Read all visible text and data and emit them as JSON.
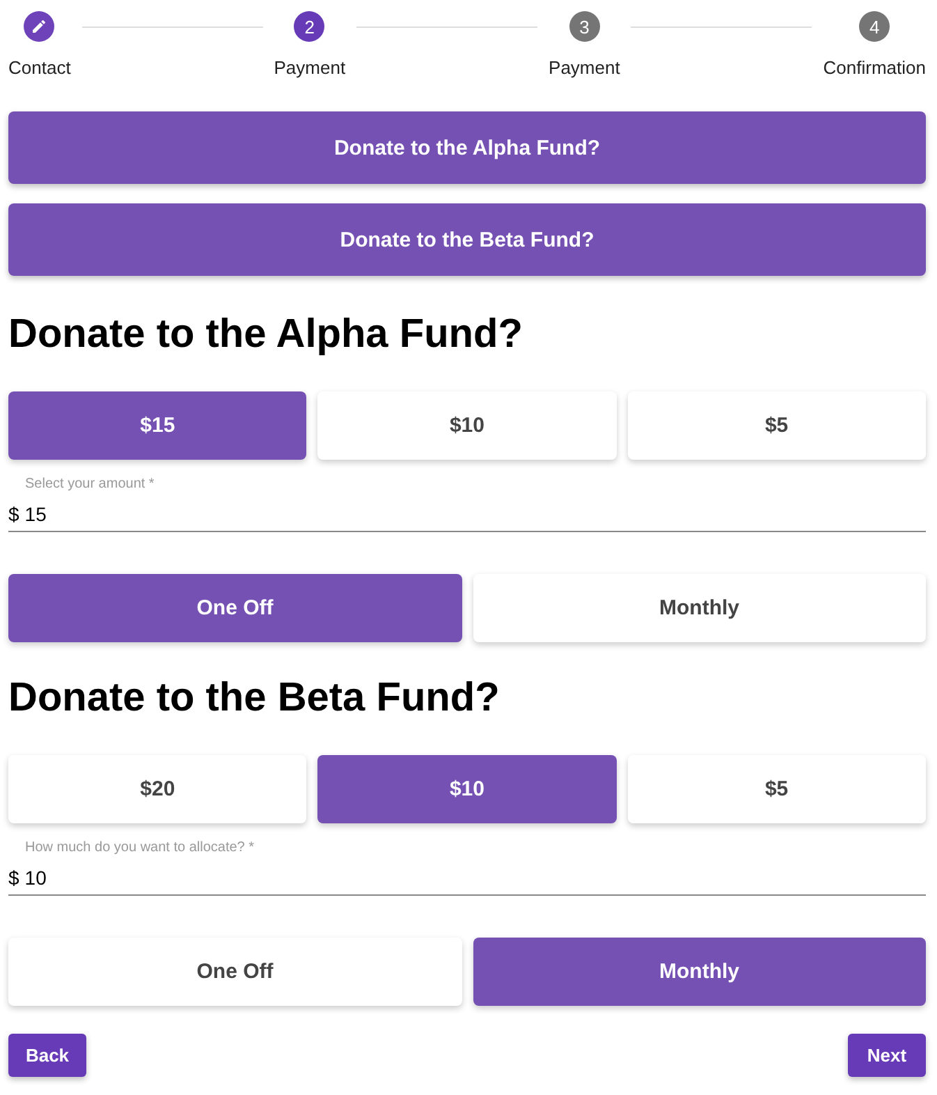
{
  "stepper": [
    {
      "label": "Contact",
      "completed": true,
      "selected": false
    },
    {
      "label": "Payment",
      "number": "2",
      "completed": false,
      "selected": true
    },
    {
      "label": "Payment",
      "number": "3",
      "completed": false,
      "selected": false
    },
    {
      "label": "Confirmation",
      "number": "4",
      "completed": false,
      "selected": false
    }
  ],
  "fund_buttons": [
    "Donate to the Alpha Fund?",
    "Donate to the Beta Fund?"
  ],
  "funds": [
    {
      "heading": "Donate to the Alpha Fund?",
      "amounts": [
        {
          "label": "$15",
          "selected": true
        },
        {
          "label": "$10",
          "selected": false
        },
        {
          "label": "$5",
          "selected": false
        }
      ],
      "field": {
        "label": "Select your amount *",
        "prefix": "$",
        "value": "15"
      },
      "frequency": [
        {
          "label": "One Off",
          "selected": true
        },
        {
          "label": "Monthly",
          "selected": false
        }
      ]
    },
    {
      "heading": "Donate to the Beta Fund?",
      "amounts": [
        {
          "label": "$20",
          "selected": false
        },
        {
          "label": "$10",
          "selected": true
        },
        {
          "label": "$5",
          "selected": false
        }
      ],
      "field": {
        "label": "How much do you want to allocate? *",
        "prefix": "$",
        "value": "10"
      },
      "frequency": [
        {
          "label": "One Off",
          "selected": false
        },
        {
          "label": "Monthly",
          "selected": true
        }
      ]
    }
  ],
  "nav": {
    "back": "Back",
    "next": "Next"
  }
}
